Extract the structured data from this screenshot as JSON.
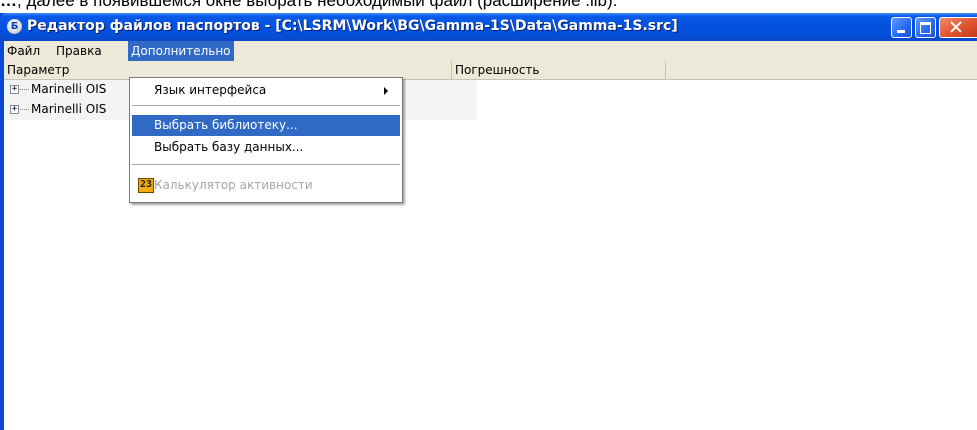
{
  "doc_text": {
    "part1": "…",
    "part2": ", далее в появившемся окне выбрать необходимый файл (расширение .lib)."
  },
  "window": {
    "title": "Редактор файлов паспортов - [C:\\LSRM\\Work\\BG\\Gamma-1S\\Data\\Gamma-1S.src]",
    "app_icon_glyph": "Б"
  },
  "menubar": {
    "items": [
      "Файл",
      "Правка",
      "Дополнительно"
    ]
  },
  "columns": {
    "param": "Параметр",
    "error": "Погрешность"
  },
  "tree": {
    "items": [
      {
        "expander": "+",
        "label": "Marinelli OIS"
      },
      {
        "expander": "+",
        "label": "Marinelli OIS"
      }
    ]
  },
  "dropdown": {
    "items": [
      {
        "label": "Язык интерфейса",
        "state": "normal"
      },
      {
        "label": "Выбрать библиотеку...",
        "state": "highlight"
      },
      {
        "label": "Выбрать базу данных...",
        "state": "normal"
      },
      {
        "label": "Калькулятор активности",
        "state": "disabled"
      }
    ],
    "calc_icon_glyph": "23"
  }
}
